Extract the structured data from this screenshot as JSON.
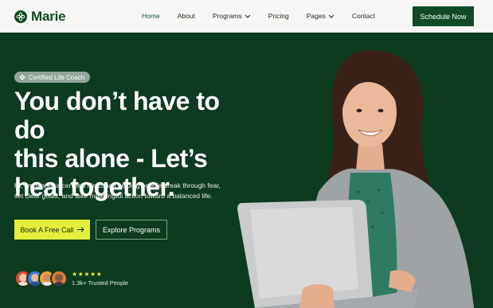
{
  "brand": {
    "name": "Marie",
    "logo_icon": "leaf-flower-icon"
  },
  "nav": {
    "items": [
      {
        "label": "Home",
        "active": true,
        "dropdown": false
      },
      {
        "label": "About",
        "active": false,
        "dropdown": false
      },
      {
        "label": "Programs",
        "active": false,
        "dropdown": true
      },
      {
        "label": "Pricing",
        "active": false,
        "dropdown": false
      },
      {
        "label": "Pages",
        "active": false,
        "dropdown": true
      },
      {
        "label": "Contact",
        "active": false,
        "dropdown": false
      }
    ],
    "cta": "Schedule Now"
  },
  "hero": {
    "badge": "Certified Life Coach",
    "title_lines": [
      "You don’t have to do",
      "this alone - Let’s",
      "heal together."
    ],
    "description": "Hi, I’m Marie, a certified life coach helping people break through fear, set clear goals, and take meaningful action toward a balanced life.",
    "primary_button": "Book A Free Call",
    "secondary_button": "Explore Programs",
    "trust": {
      "stars": "★★★★★",
      "rating": 5,
      "label": "1.3k+ Trusted People"
    }
  },
  "colors": {
    "primary_green": "#0f4a25",
    "hero_bg": "#0c3b1f",
    "accent_yellow": "#e6ee3c",
    "header_bg": "#f6f7f4"
  }
}
